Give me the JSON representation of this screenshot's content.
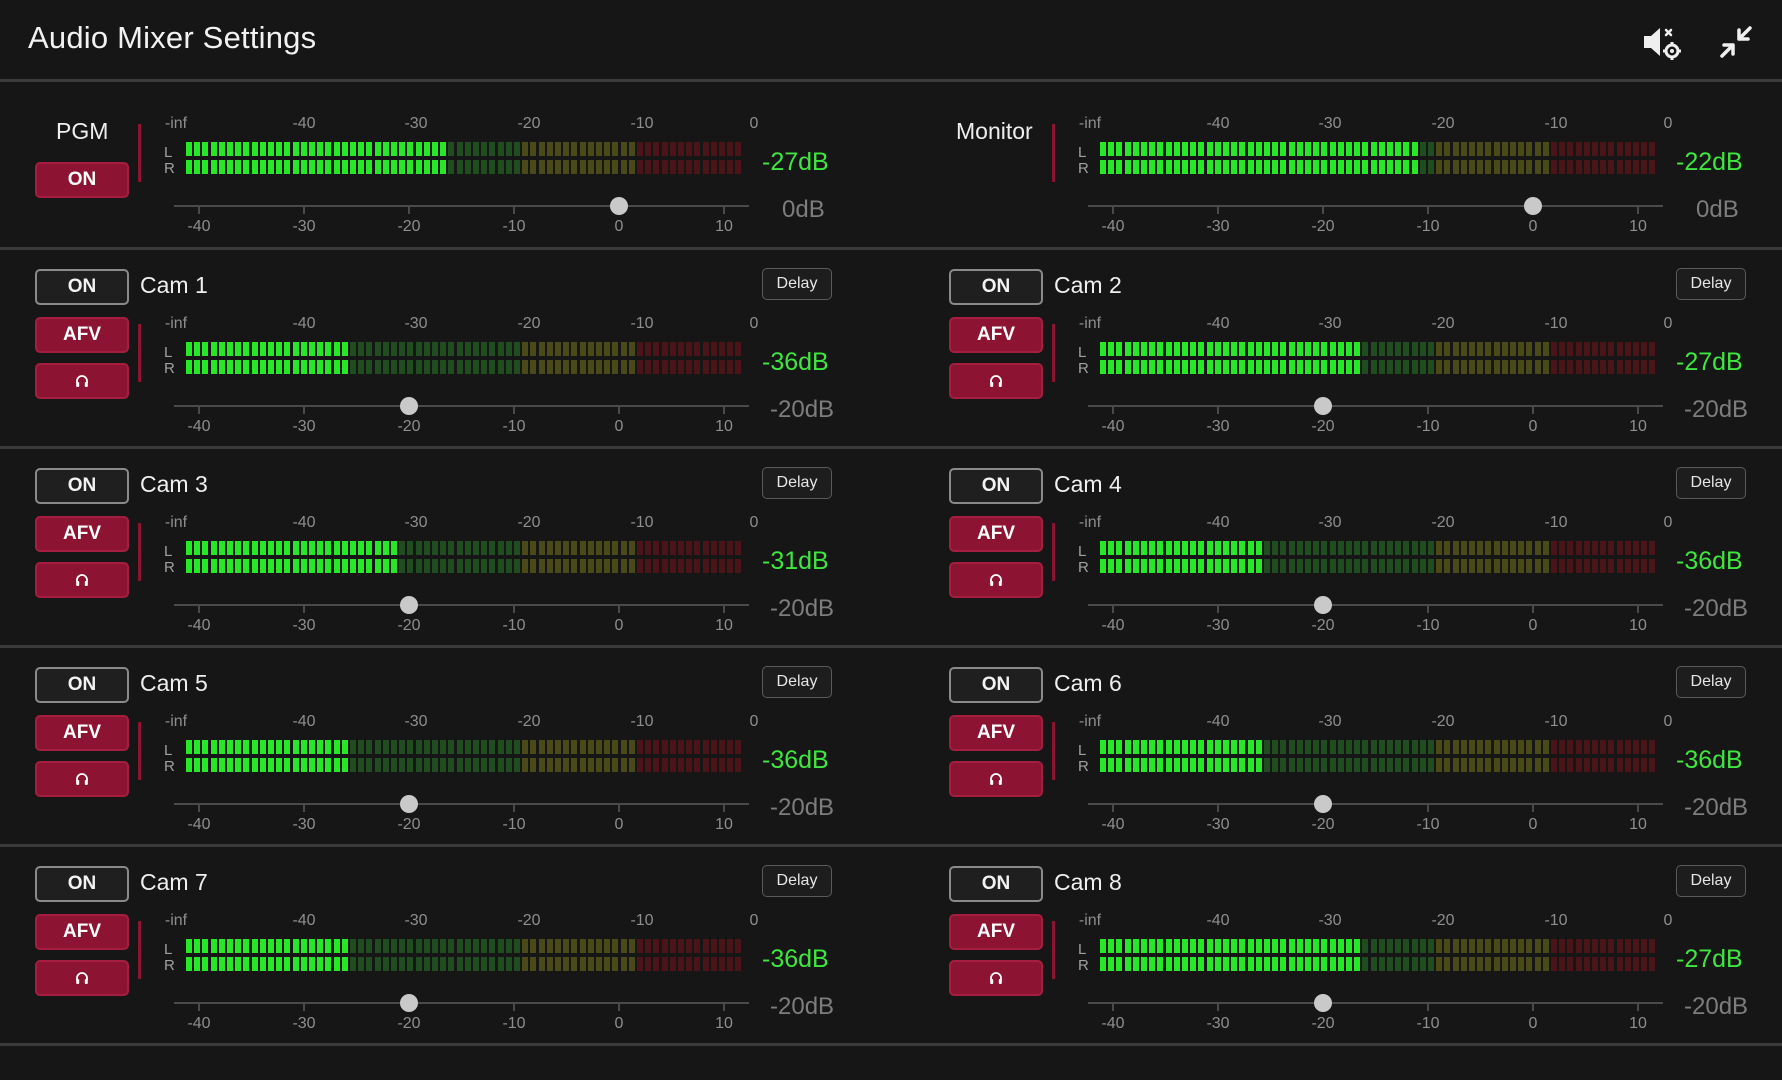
{
  "title": "Audio Mixer Settings",
  "colors": {
    "accent": "#8c1432",
    "meter_green_on": "#27e827",
    "meter_green_off": "#1f4d1f",
    "meter_yellow_off": "#4a4a18",
    "meter_red_off": "#4a1418",
    "level_text": "#3fe63f"
  },
  "icons": {
    "speaker_settings": "speaker-settings-icon",
    "collapse": "collapse-icon",
    "headphone": "headphone-icon"
  },
  "meter_scale": [
    "-inf",
    "-40",
    "-30",
    "-20",
    "-10",
    "0"
  ],
  "fader_scale": [
    "-40",
    "-30",
    "-20",
    "-10",
    "0",
    "10"
  ],
  "channel_labels": {
    "L": "L",
    "R": "R"
  },
  "master": [
    {
      "name": "PGM",
      "on_label": "ON",
      "level": "-27dB",
      "level_value": -27,
      "gain": "0dB",
      "gain_value": 0
    },
    {
      "name": "Monitor",
      "level": "-22dB",
      "level_value": -22,
      "gain": "0dB",
      "gain_value": 0
    }
  ],
  "channels": [
    {
      "name": "Cam 1",
      "on_label": "ON",
      "afv_label": "AFV",
      "delay_label": "Delay",
      "level": "-36dB",
      "level_value": -36,
      "gain": "-20dB",
      "gain_value": -20
    },
    {
      "name": "Cam 2",
      "on_label": "ON",
      "afv_label": "AFV",
      "delay_label": "Delay",
      "level": "-27dB",
      "level_value": -27,
      "gain": "-20dB",
      "gain_value": -20
    },
    {
      "name": "Cam 3",
      "on_label": "ON",
      "afv_label": "AFV",
      "delay_label": "Delay",
      "level": "-31dB",
      "level_value": -31,
      "gain": "-20dB",
      "gain_value": -20
    },
    {
      "name": "Cam 4",
      "on_label": "ON",
      "afv_label": "AFV",
      "delay_label": "Delay",
      "level": "-36dB",
      "level_value": -36,
      "gain": "-20dB",
      "gain_value": -20
    },
    {
      "name": "Cam 5",
      "on_label": "ON",
      "afv_label": "AFV",
      "delay_label": "Delay",
      "level": "-36dB",
      "level_value": -36,
      "gain": "-20dB",
      "gain_value": -20
    },
    {
      "name": "Cam 6",
      "on_label": "ON",
      "afv_label": "AFV",
      "delay_label": "Delay",
      "level": "-36dB",
      "level_value": -36,
      "gain": "-20dB",
      "gain_value": -20
    },
    {
      "name": "Cam 7",
      "on_label": "ON",
      "afv_label": "AFV",
      "delay_label": "Delay",
      "level": "-36dB",
      "level_value": -36,
      "gain": "-20dB",
      "gain_value": -20
    },
    {
      "name": "Cam 8",
      "on_label": "ON",
      "afv_label": "AFV",
      "delay_label": "Delay",
      "level": "-27dB",
      "level_value": -27,
      "gain": "-20dB",
      "gain_value": -20
    }
  ]
}
